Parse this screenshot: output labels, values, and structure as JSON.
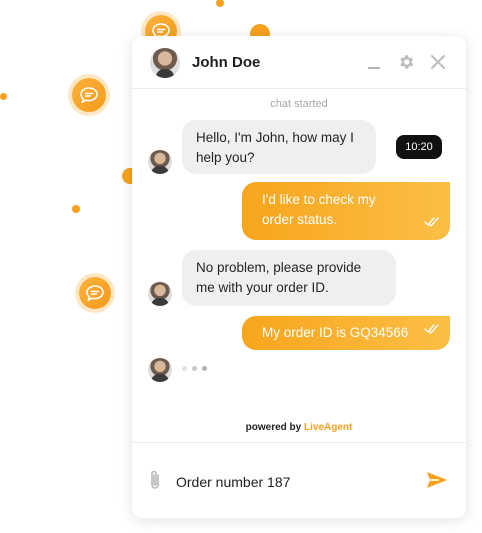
{
  "header": {
    "agent_name": "John Doe",
    "icons": [
      "minimize-icon",
      "gear-icon",
      "close-icon"
    ]
  },
  "chat": {
    "started_label": "chat started",
    "messages": [
      {
        "from": "agent",
        "line1": "Hello, I'm John, how may I",
        "line2": "help you?"
      },
      {
        "from": "visitor",
        "line1": "I'd like to check my",
        "line2": "order status."
      },
      {
        "from": "agent",
        "line1": "No problem, please provide",
        "line2": "me with your order ID."
      },
      {
        "from": "visitor",
        "line1": "My order ID is GQ34566"
      }
    ],
    "time_badge": "10:20"
  },
  "footer": {
    "powered_prefix": "powered by",
    "powered_brand": "LiveAgent"
  },
  "composer": {
    "value": "Order number 187",
    "attach_icon": "paperclip-icon",
    "send_icon": "send-icon"
  },
  "colors": {
    "accent": "#f7a11f",
    "agent_bubble": "#efeff1",
    "badge": "#111111"
  }
}
